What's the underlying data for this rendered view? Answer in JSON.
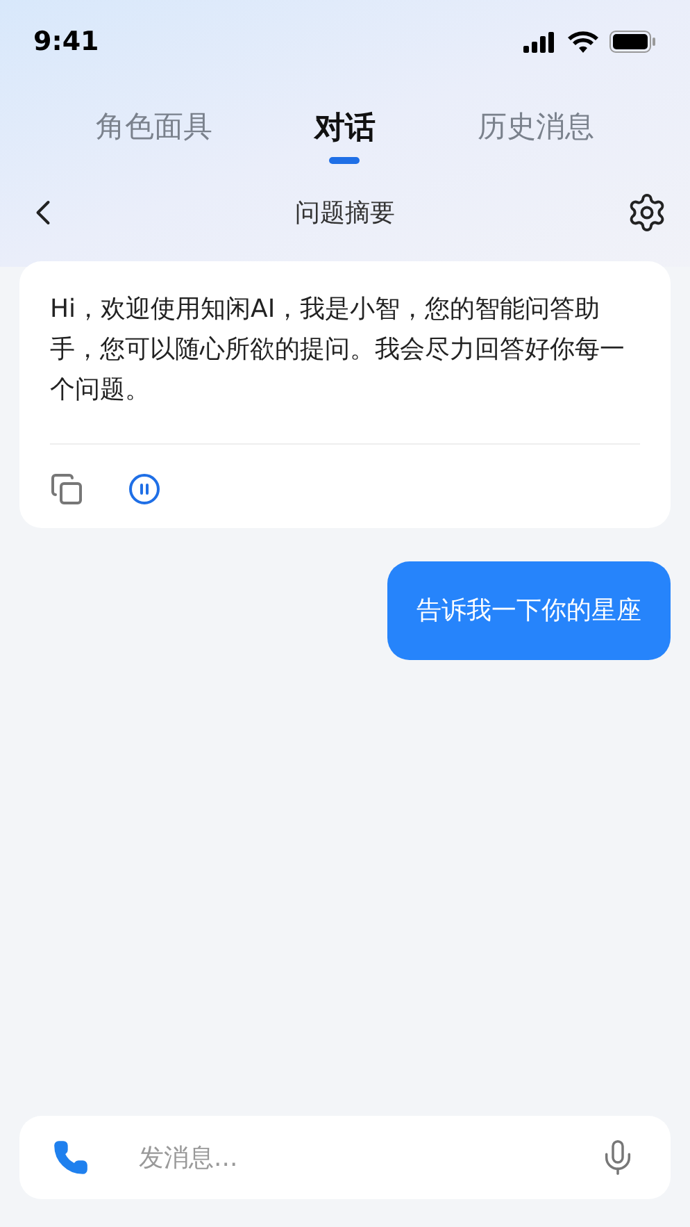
{
  "status_bar": {
    "time": "9:41"
  },
  "tabs": [
    {
      "label": "角色面具",
      "selected": false
    },
    {
      "label": "对话",
      "selected": true
    },
    {
      "label": "历史消息",
      "selected": false
    }
  ],
  "header": {
    "title": "问题摘要"
  },
  "messages": [
    {
      "kind": "bot",
      "text": "Hi，欢迎使用知闲AI，我是小智，您的智能问答助手，您可以随心所欲的提问。我会尽力回答好你每一个问题。"
    },
    {
      "kind": "user",
      "text": "告诉我一下你的星座"
    }
  ],
  "composer": {
    "placeholder": "发消息..."
  }
}
